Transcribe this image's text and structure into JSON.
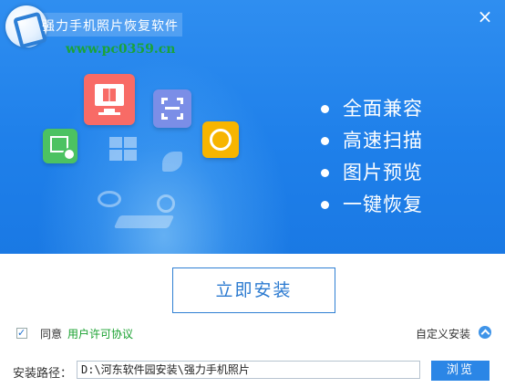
{
  "window": {
    "title": "强力手机照片恢复软件",
    "watermark": "www.pc0359.cn",
    "close_label": "×"
  },
  "features": [
    "全面兼容",
    "高速扫描",
    "图片预览",
    "一键恢复"
  ],
  "install": {
    "button_label": "立即安装"
  },
  "agreement": {
    "checked": true,
    "label": "同意",
    "link_label": "用户许可协议"
  },
  "custom": {
    "label": "自定义安装"
  },
  "path": {
    "label": "安装路径：",
    "value": "D:\\河东软件园安装\\强力手机照片",
    "browse_label": "浏览"
  },
  "icons": [
    "app-logo-icon",
    "computer-icon",
    "scan-icon",
    "copyright-icon",
    "image-view-icon",
    "windows-icon",
    "rocket-icon",
    "eye-icon",
    "magnifier-icon",
    "chevron-up-icon"
  ],
  "colors": {
    "banner": "#1f80ea",
    "accent": "#2b86e6",
    "link": "#17a02e"
  }
}
